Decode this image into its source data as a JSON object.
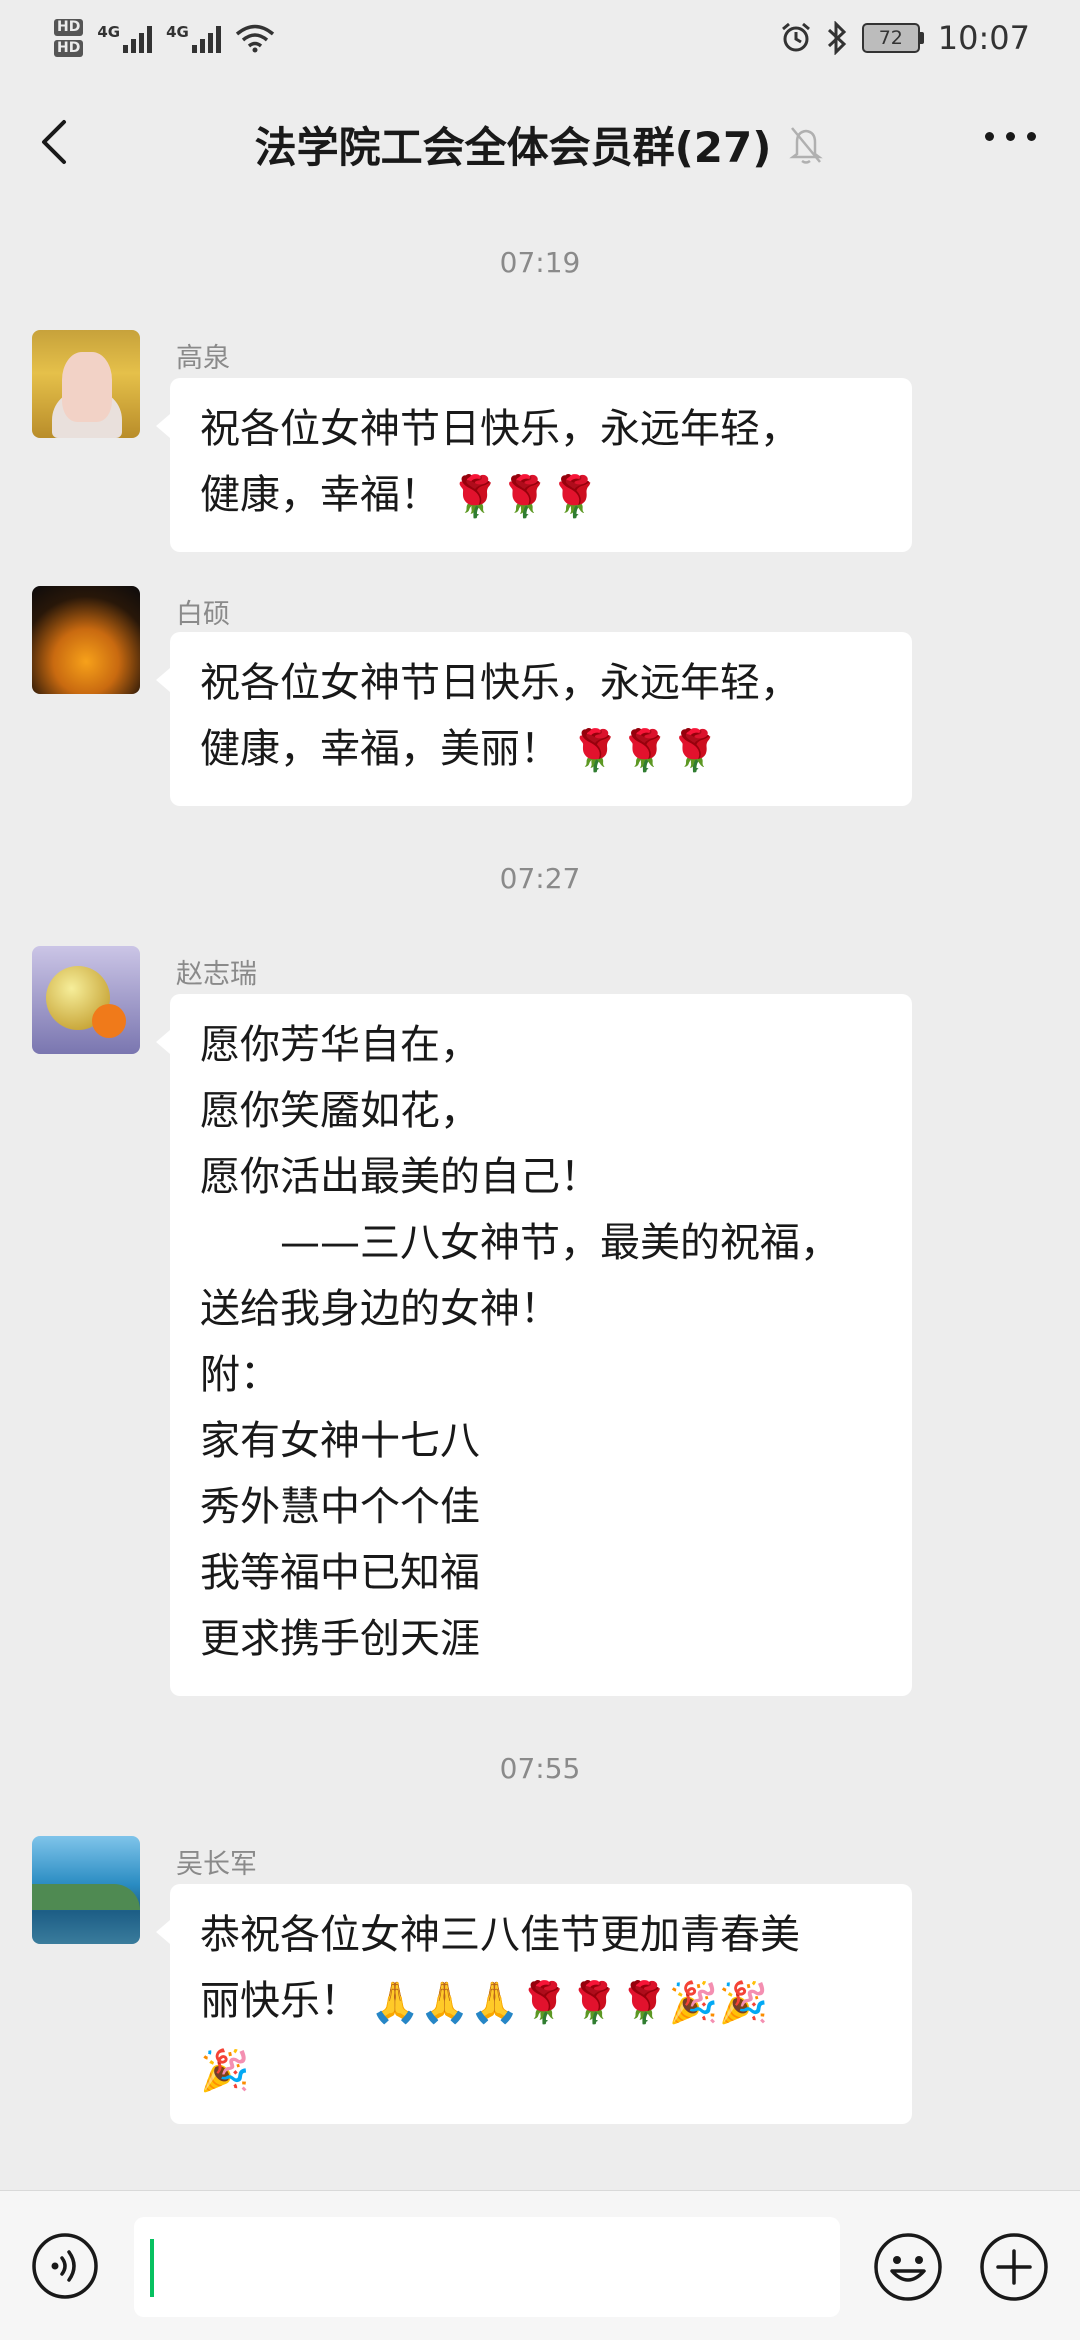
{
  "status_bar": {
    "hd1": "HD",
    "hd2": "HD",
    "net1": "4G",
    "net2": "4G",
    "battery": "72",
    "time": "10:07"
  },
  "header": {
    "title": "法学院工会全体会员群(27)"
  },
  "messages": [
    {
      "time": "07:19",
      "sender": "高泉",
      "lines": [
        "祝各位女神节日快乐，永远年轻，",
        "健康，幸福！"
      ],
      "emoji": "🌹🌹🌹"
    },
    {
      "sender": "白硕",
      "lines": [
        "祝各位女神节日快乐，永远年轻，",
        "健康，幸福，美丽！"
      ],
      "emoji": "🌹🌹🌹"
    },
    {
      "time": "07:27",
      "sender": "赵志瑞",
      "lines": [
        "愿你芳华自在，",
        "愿你笑靥如花，",
        "愿你活出最美的自己！",
        "　　——三八女神节，最美的祝福，",
        "送给我身边的女神！",
        "附：",
        "家有女神十七八",
        "秀外慧中个个佳",
        "我等福中已知福",
        "更求携手创天涯"
      ]
    },
    {
      "time": "07:55",
      "sender": "吴长军",
      "lines": [
        "恭祝各位女神三八佳节更加青春美",
        "丽快乐！"
      ],
      "emoji": "🙏🙏🙏🌹🌹🌹🎉🎉",
      "emoji_extra": "🎉"
    }
  ],
  "colors": {
    "background": "#ededed",
    "bubble": "#ffffff",
    "caret": "#07c160"
  },
  "input": {
    "value": "",
    "placeholder": ""
  }
}
